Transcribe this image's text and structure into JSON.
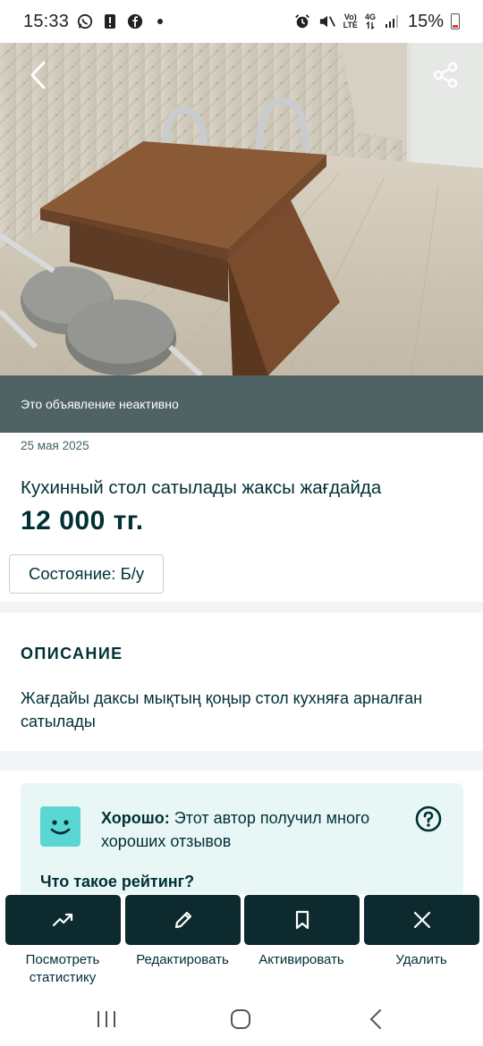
{
  "status_bar": {
    "time": "15:33",
    "network_top": "Vo)",
    "network_bottom": "LTE",
    "signal_type": "4G",
    "battery": "15%",
    "left_icons": [
      "whatsapp-icon",
      "alert-icon",
      "facebook-icon",
      "dot-icon"
    ],
    "right_icons": [
      "alarm-icon",
      "mute-icon",
      "signal-icon",
      "battery-icon"
    ]
  },
  "listing": {
    "inactive_notice": "Это объявление неактивно",
    "date": "25 мая 2025",
    "title": "Кухинный стол сатылады жаксы жағдайда",
    "price": "12 000 тг.",
    "condition": "Состояние: Б/у"
  },
  "description": {
    "heading": "ОПИСАНИЕ",
    "text": "Жағдайы даксы мықтың қоңыр стол кухняға арналған сатылады"
  },
  "rating": {
    "label": "Хорошо:",
    "text": " Этот автор получил много хороших отзывов",
    "link": "Что такое рейтинг?"
  },
  "actions": [
    {
      "label": "Посмотреть статистику",
      "icon": "chart-trend-icon"
    },
    {
      "label": "Редактировать",
      "icon": "pencil-icon"
    },
    {
      "label": "Активировать",
      "icon": "bookmark-icon"
    },
    {
      "label": "Удалить",
      "icon": "close-icon"
    }
  ],
  "colors": {
    "brand_dark": "#002f34",
    "action_bg": "#0d2b2f",
    "banner_bg": "#4f6364",
    "rating_bg": "#e8f7f6",
    "rating_face": "#5ad6d4"
  }
}
